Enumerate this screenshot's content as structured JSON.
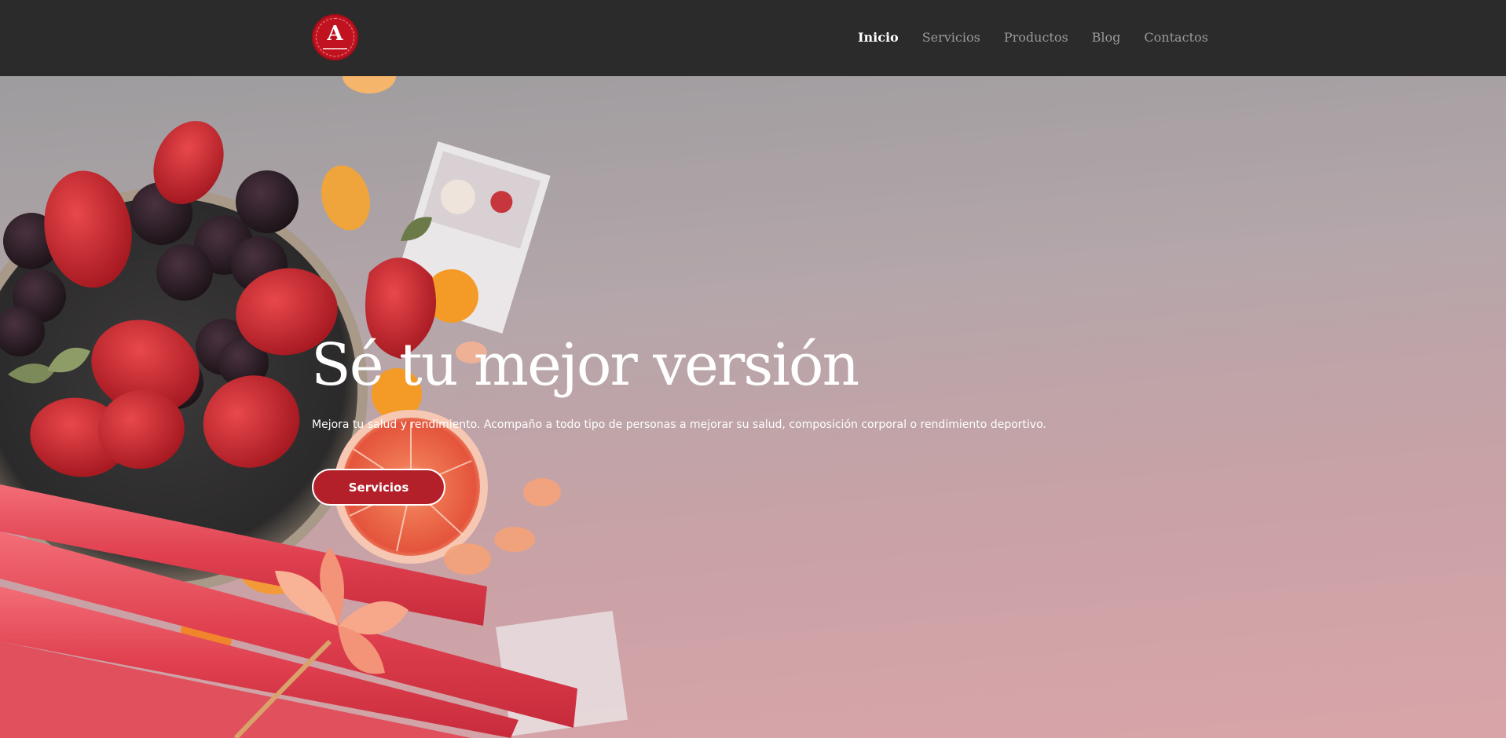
{
  "header": {
    "logo_icon": "brand-logo-icon",
    "logo_letter": "A",
    "nav": [
      {
        "label": "Inicio",
        "active": true
      },
      {
        "label": "Servicios",
        "active": false
      },
      {
        "label": "Productos",
        "active": false
      },
      {
        "label": "Blog",
        "active": false
      },
      {
        "label": "Contactos",
        "active": false
      }
    ]
  },
  "hero": {
    "title": "Sé tu mejor versión",
    "subtitle": "Mejora tu salud y rendimiento. Acompaño a todo tipo de personas a mejorar su salud, composición corporal o rendimiento deportivo.",
    "button_label": "Servicios"
  },
  "colors": {
    "navbar": "#2b2b2b",
    "accent": "#b3202a",
    "logo": "#c1121f",
    "nav_inactive": "#9a9a9a"
  }
}
